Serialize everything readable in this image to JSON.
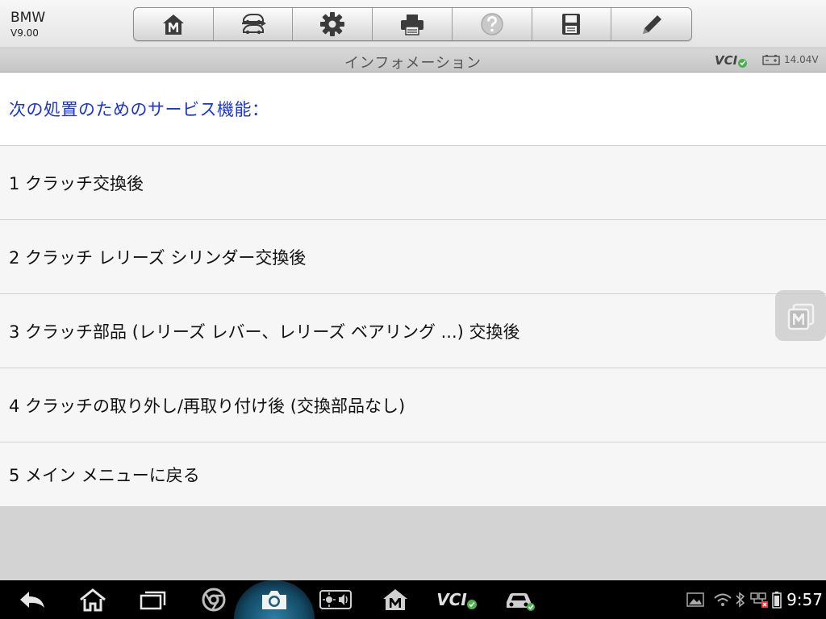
{
  "app": {
    "name": "BMW",
    "version": "V9.00"
  },
  "titlebar": {
    "title": "インフォメーション",
    "vci_label": "VCI",
    "battery_voltage": "14.04V"
  },
  "content": {
    "header": "次の処置のためのサービス機能：",
    "items": [
      {
        "label": "1 クラッチ交換後"
      },
      {
        "label": "2 クラッチ レリーズ シリンダー交換後"
      },
      {
        "label": "3 クラッチ部品 (レリーズ レバー、レリーズ ベアリング ...) 交換後"
      },
      {
        "label": "4 クラッチの取り外し/再取り付け後 (交換部品なし)"
      },
      {
        "label": "5 メイン メニューに戻る"
      }
    ]
  },
  "toolbar": {
    "buttons": [
      "home-icon",
      "vehicle-swap-icon",
      "gear-icon",
      "printer-icon",
      "help-icon",
      "save-icon",
      "pencil-icon"
    ]
  },
  "navbar": {
    "vci_label": "VCI",
    "clock": "9:57"
  },
  "colors": {
    "header_text": "#1a33d6",
    "status_ok": "#4caf50",
    "nav_background": "#000000"
  }
}
